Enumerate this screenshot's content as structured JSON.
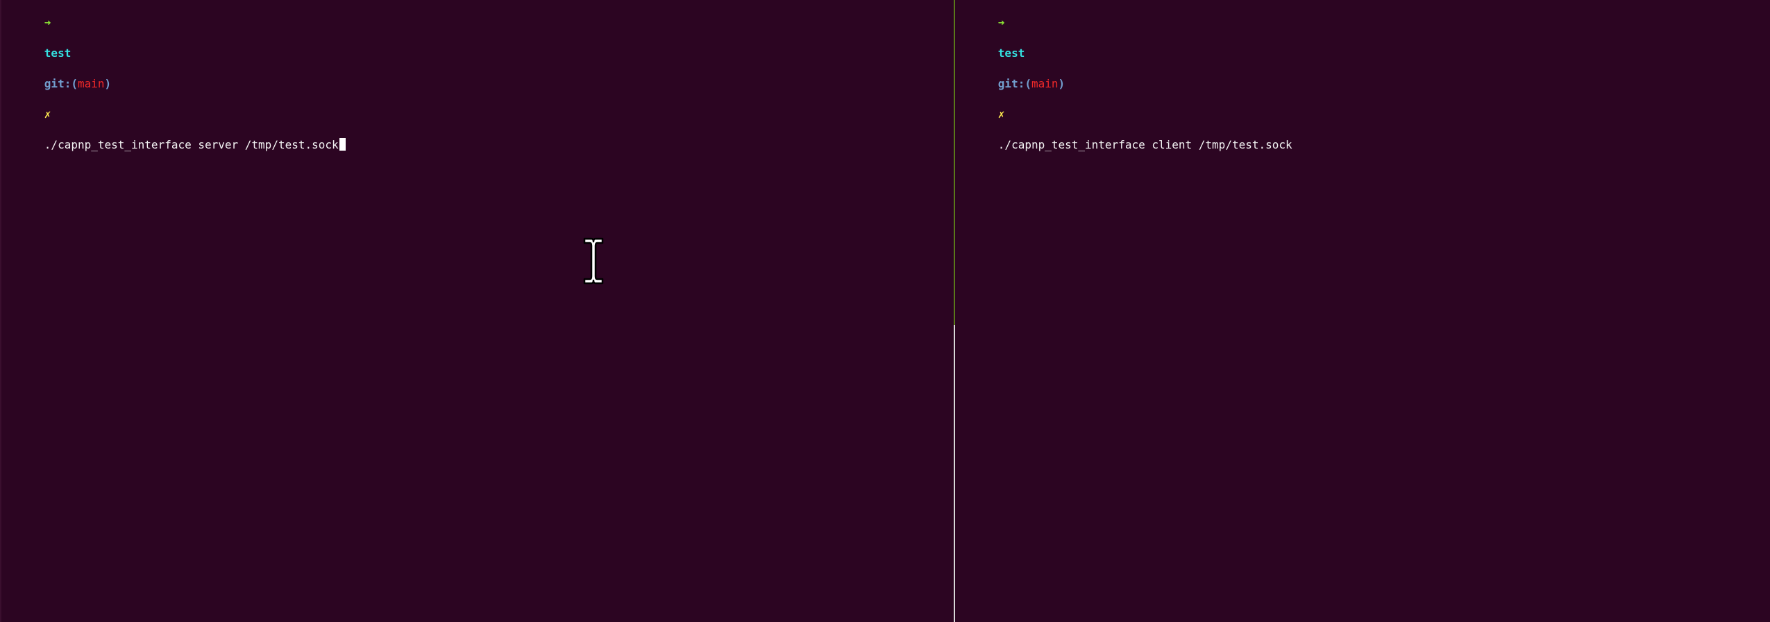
{
  "colors": {
    "background": "#2c0522",
    "arrow": "#8ae234",
    "directory": "#34e2e2",
    "git": "#729fcf",
    "branch": "#ef2929",
    "dirty": "#fce94f",
    "text": "#f2f2f2",
    "divider_top": "#5a7a1a",
    "divider_bottom": "#d8d8d8",
    "cursor": "#ffffff"
  },
  "left_pane": {
    "prompt": {
      "arrow": "➜",
      "directory": "test",
      "git_prefix": "git:(",
      "branch": "main",
      "git_suffix": ")",
      "dirty_mark": "✗",
      "command": "./capnp_test_interface server /tmp/test.sock"
    },
    "cursor_icon": "block-cursor-icon"
  },
  "right_pane": {
    "prompt": {
      "arrow": "➜",
      "directory": "test",
      "git_prefix": "git:(",
      "branch": "main",
      "git_suffix": ")",
      "dirty_mark": "✗",
      "command": "./capnp_test_interface client /tmp/test.sock"
    }
  },
  "mouse_cursor_icon": "ibeam-cursor-icon"
}
